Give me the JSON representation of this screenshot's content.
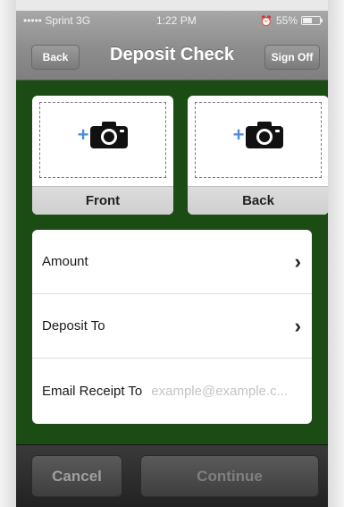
{
  "status": {
    "carrier": "••••• Sprint  3G",
    "time": "1:22 PM",
    "battery": "55%"
  },
  "nav": {
    "back_label": "Back",
    "title": "Deposit Check",
    "signoff_label": "Sign Off"
  },
  "capture": {
    "front_label": "Front",
    "back_label": "Back",
    "plus_icon": "+"
  },
  "form": {
    "amount_label": "Amount",
    "deposit_to_label": "Deposit To",
    "email_label": "Email Receipt To",
    "email_placeholder": "example@example.c...",
    "chevron": "›"
  },
  "actions": {
    "cancel_label": "Cancel",
    "continue_label": "Continue"
  },
  "colors": {
    "content_bg": "#1b4c14",
    "accent_plus": "#4b8fdc"
  }
}
